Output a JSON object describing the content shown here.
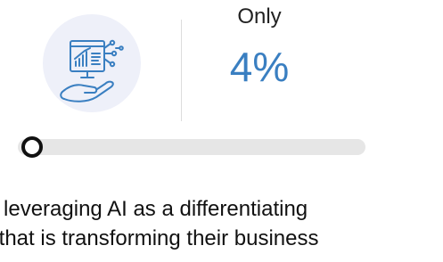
{
  "stat": {
    "prefix_label": "Only",
    "value_label": "4%",
    "value_percent": 4,
    "accent_color": "#3a7fc1"
  },
  "icon": {
    "name": "ai-analytics-hand-icon",
    "circle_color": "#eef0f9",
    "stroke_color": "#3a7fc1"
  },
  "progress": {
    "fraction": 0.04,
    "track_color": "#e6e6e6",
    "knob_color": "#111111"
  },
  "caption": {
    "line1": "e leveraging AI as a differentiating",
    "line2": "r that is transforming their business"
  }
}
